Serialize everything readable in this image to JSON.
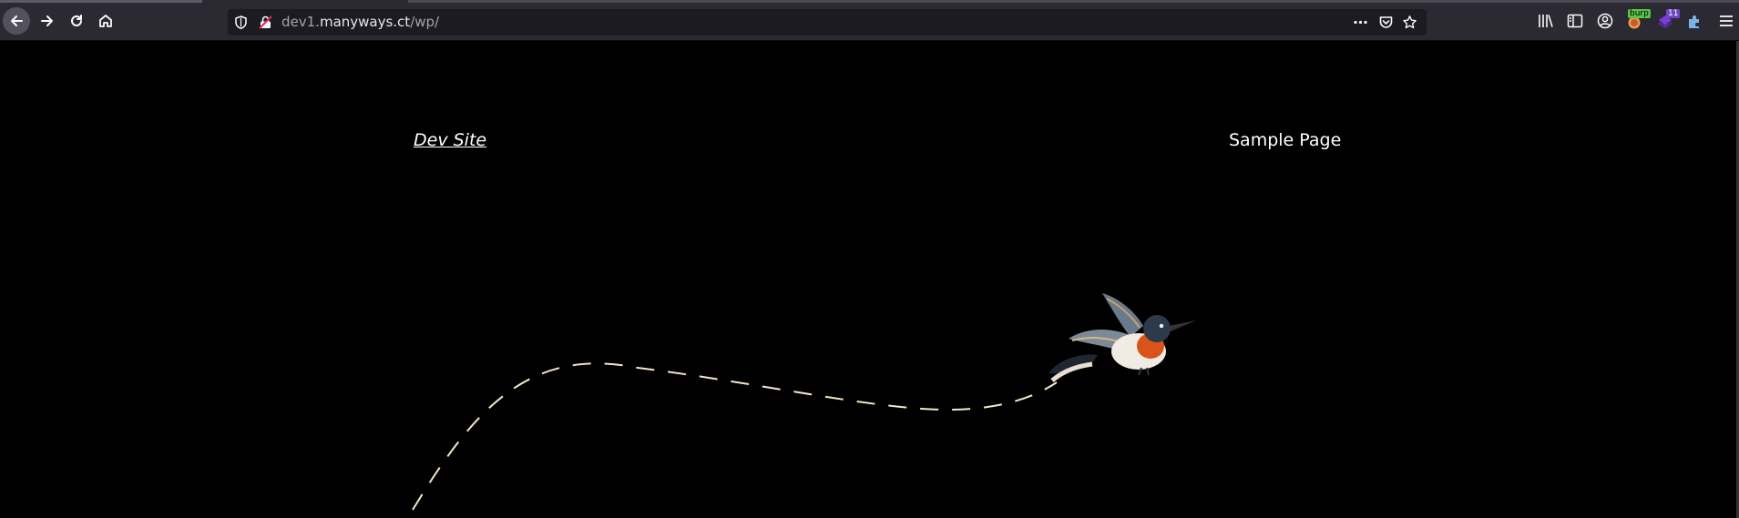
{
  "browser": {
    "url": {
      "prefix": "dev1.",
      "host": "manyways.ct",
      "path": "/wp/"
    },
    "extensions": {
      "burp_badge": "burp",
      "count_badge": "11"
    },
    "icons": [
      "back-arrow-icon",
      "forward-arrow-icon",
      "reload-icon",
      "home-icon",
      "shield-icon",
      "insecure-lock-icon",
      "more-dots-icon",
      "pocket-icon",
      "star-icon",
      "library-icon",
      "sidebar-icon",
      "account-icon",
      "burp-extension-icon",
      "extension-icon",
      "extension-puzzle-icon",
      "menu-icon"
    ],
    "colors": {
      "toolbar": "#2b2a33",
      "urlbar": "#1c1b22",
      "page_bg": "#000000"
    }
  },
  "page": {
    "site_title": "Dev Site",
    "nav": {
      "sample_page": "Sample Page"
    }
  }
}
